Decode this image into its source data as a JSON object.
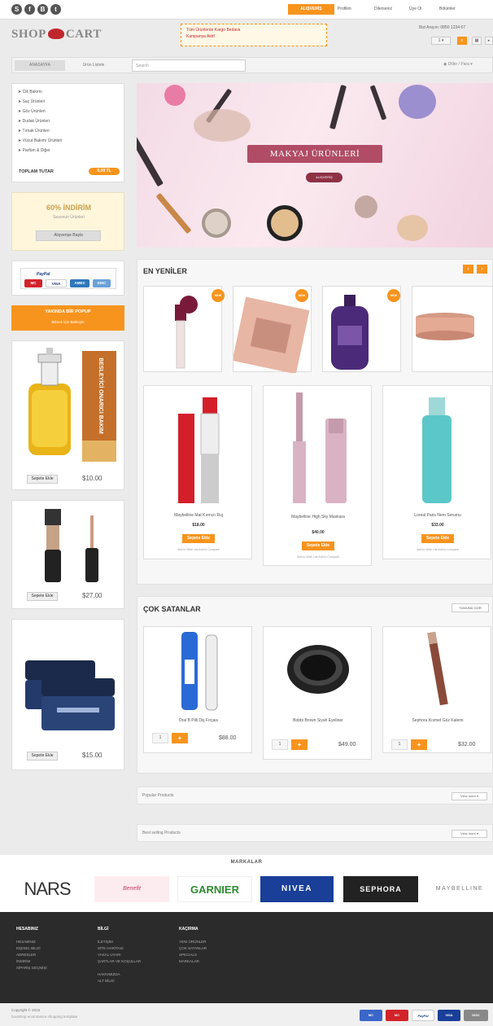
{
  "topbar": {
    "account_label": "ALIŞVERİŞ",
    "links": [
      "Profilim",
      "Dilerseniz",
      "Üye Ol",
      "Bölümler"
    ],
    "social": [
      {
        "icon": "skype-icon",
        "glyph": "S"
      },
      {
        "icon": "facebook-icon",
        "glyph": "f"
      },
      {
        "icon": "blog-icon",
        "glyph": "B"
      },
      {
        "icon": "twitter-icon",
        "glyph": "t"
      }
    ]
  },
  "header": {
    "logo_left": "SHOP",
    "logo_right": "CART",
    "promo_line1": "Tüm Ürünlerde Kargo Bedava",
    "promo_line2": "Kampanya Aktif",
    "phone": "Bizi Arayın: 0850 1234 67",
    "cart_count": "1",
    "nav_tabs": [
      "ANASAYFA",
      "Ürün Listele"
    ],
    "search_placeholder": "Search",
    "language": "Diller / Para"
  },
  "sidebar": {
    "categories": [
      "Cilt Bakımı",
      "Saç Ürünleri",
      "Göz Ürünleri",
      "Dudak Ürünleri",
      "Tırnak Ürünleri",
      "Vücut Bakımı Ürünleri",
      "Parfüm & Diğer"
    ],
    "total_label": "TOPLAM TUTAR",
    "total_value": "0,00 TL",
    "sale_title": "60% İNDİRİM",
    "sale_sub": "Sezonun Ürünleri",
    "sale_button": "Alışverişe Başla",
    "paypal": "PayPal",
    "cards": [
      "MC",
      "VISA",
      "AMEX",
      "DISC"
    ],
    "coming_title": "YAKINDA BİR POPUP",
    "coming_sub": "Bilmek İçin Bekleyin",
    "products": [
      {
        "button": "Sepete Ekle",
        "price": "$10.00",
        "label": "BESLEYİCİ ONARICI BAKIM"
      },
      {
        "button": "Sepete Ekle",
        "price": "$27.00"
      },
      {
        "button": "Sepete Ekle",
        "price": "$15.00"
      }
    ]
  },
  "slider": {
    "title": "MAKYAJ ÜRÜNLERİ",
    "button": "ALIŞVERİŞ"
  },
  "new": {
    "title": "EN YENİLER",
    "badge": "NEW",
    "products": [
      {
        "name": "Maybelline Mat Kırmızı Ruj",
        "price": "$18.00",
        "button": "Sepete Ekle",
        "links": "Add to Wish List   Add to Compare"
      },
      {
        "name": "Maybelline High Sky Maskara",
        "price": "$40.00",
        "button": "Sepete Ekle",
        "links": "Add to Wish List   Add to Compare"
      },
      {
        "name": "Loreal Paris Nem Serumu",
        "price": "$33.00",
        "button": "Sepete Ekle",
        "links": "Add to Wish List   Add to Compare"
      }
    ]
  },
  "best": {
    "title": "ÇOK SATANLAR",
    "view_all": "TÜMÜNÜ GÖR",
    "products": [
      {
        "name": "Oral B Pilli Diş Fırçası",
        "price": "$88.00",
        "qty": "1"
      },
      {
        "name": "Bobbi Brown Siyah Eyeliner",
        "price": "$49.00",
        "qty": "1"
      },
      {
        "name": "Sephora Kısmet Göz Kalemi",
        "price": "$32.00",
        "qty": "1"
      }
    ]
  },
  "bars": [
    {
      "title": "Popular Products",
      "button": "View more ▾"
    },
    {
      "title": "Best selling Products",
      "button": "View more ▾"
    }
  ],
  "brands": {
    "title": "MARKALAR",
    "items": [
      "NARS",
      "Benefit",
      "GARNIER",
      "NIVEA",
      "SEPHORA",
      "MAYBELLINE"
    ]
  },
  "footer": {
    "columns": [
      {
        "head": "HESABINIZ",
        "items": [
          "HESABINIZ",
          "KİŞİSEL BİLGİ",
          "ADRESLER",
          "İNDİRİM",
          "SİPARİŞ GEÇMİŞİ"
        ]
      },
      {
        "head": "BİLGİ",
        "items": [
          "İLETİŞİM",
          "SİTE HARİTASI",
          "YASAL UYARI",
          "ŞARTLAR VE KOŞULLAR",
          "HAKKIMIZDA",
          "ALT BİLGİ"
        ]
      },
      {
        "head": "KAÇIRMA",
        "items": [
          "YENİ ÜRÜNLER",
          "ÇOK SATANLAR",
          "SPECIALS",
          "MARKALAR"
        ]
      }
    ],
    "copyright": "Copyright © 2015",
    "powered": "bootshop ecommerce shopping template",
    "pay_cards": [
      "MC",
      "MC",
      "PayPal",
      "VISA",
      "DISC"
    ]
  },
  "colors": {
    "accent": "#f7941d",
    "logo_red": "#c0272d",
    "footer_bg": "#2b2b2b",
    "nivea_blue": "#1a3f99"
  }
}
